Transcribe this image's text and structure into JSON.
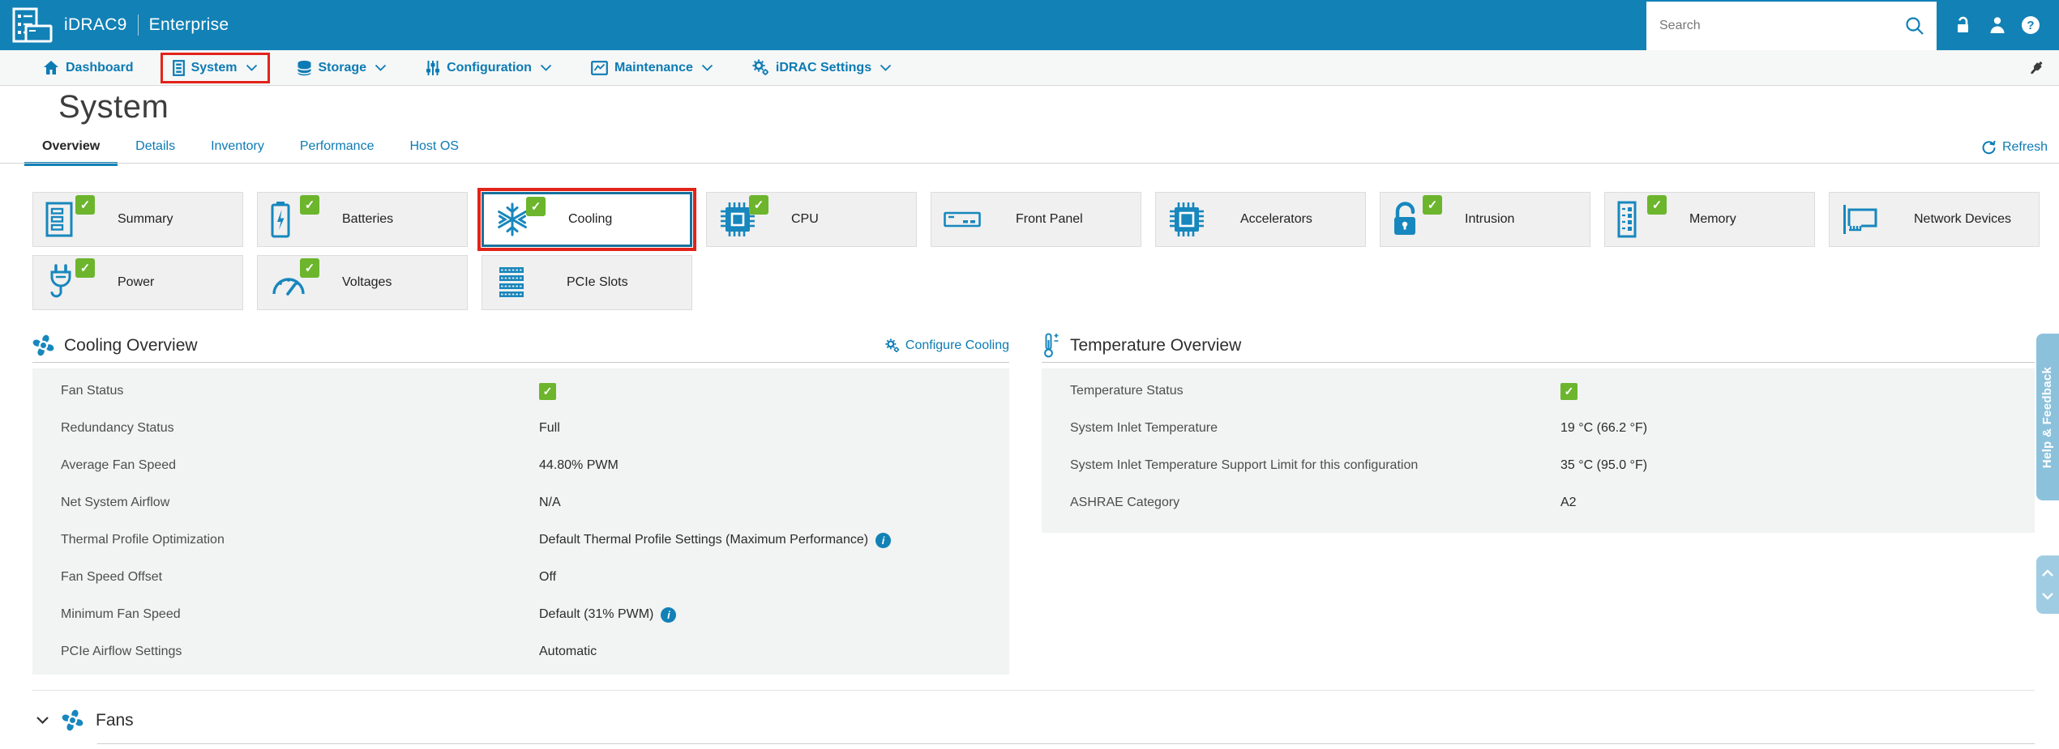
{
  "colors": {
    "header_blue": "#1181b6",
    "link_blue": "#0c7bb4",
    "tile_icon_blue": "#1787bd",
    "status_green": "#6cb52d",
    "annotation_red": "#e2231a",
    "panel_gray": "#f2f3f3",
    "help_tab_blue": "#8cc1dc",
    "scroll_button_blue": "#9fcce2"
  },
  "icons": {
    "check": "✓",
    "info": "i",
    "question": "?"
  },
  "header": {
    "brand": "iDRAC9",
    "edition": "Enterprise",
    "search_placeholder": "Search"
  },
  "nav": {
    "items": [
      {
        "label": "Dashboard",
        "dropdown": false,
        "annotated": false
      },
      {
        "label": "System",
        "dropdown": true,
        "annotated": true
      },
      {
        "label": "Storage",
        "dropdown": true,
        "annotated": false
      },
      {
        "label": "Configuration",
        "dropdown": true,
        "annotated": false
      },
      {
        "label": "Maintenance",
        "dropdown": true,
        "annotated": false
      },
      {
        "label": "iDRAC Settings",
        "dropdown": true,
        "annotated": false
      }
    ]
  },
  "page": {
    "title": "System"
  },
  "tabs": {
    "items": [
      {
        "label": "Overview",
        "active": true
      },
      {
        "label": "Details",
        "active": false
      },
      {
        "label": "Inventory",
        "active": false
      },
      {
        "label": "Performance",
        "active": false
      },
      {
        "label": "Host OS",
        "active": false
      }
    ],
    "refresh_label": "Refresh"
  },
  "tiles": {
    "items": [
      {
        "label": "Summary",
        "checked": true,
        "selected": false,
        "annotated": false
      },
      {
        "label": "Batteries",
        "checked": true,
        "selected": false,
        "annotated": false
      },
      {
        "label": "Cooling",
        "checked": true,
        "selected": true,
        "annotated": true
      },
      {
        "label": "CPU",
        "checked": true,
        "selected": false,
        "annotated": false
      },
      {
        "label": "Front Panel",
        "checked": false,
        "selected": false,
        "annotated": false
      },
      {
        "label": "Accelerators",
        "checked": false,
        "selected": false,
        "annotated": false
      },
      {
        "label": "Intrusion",
        "checked": true,
        "selected": false,
        "annotated": false
      },
      {
        "label": "Memory",
        "checked": true,
        "selected": false,
        "annotated": false
      },
      {
        "label": "Network Devices",
        "checked": false,
        "selected": false,
        "annotated": false
      },
      {
        "label": "Power",
        "checked": true,
        "selected": false,
        "annotated": false
      },
      {
        "label": "Voltages",
        "checked": true,
        "selected": false,
        "annotated": false
      },
      {
        "label": "PCIe Slots",
        "checked": false,
        "selected": false,
        "annotated": false
      }
    ]
  },
  "cooling_overview": {
    "title": "Cooling Overview",
    "configure_label": "Configure Cooling",
    "rows": [
      {
        "label": "Fan Status",
        "value": "",
        "status_ok": true
      },
      {
        "label": "Redundancy Status",
        "value": "Full"
      },
      {
        "label": "Average Fan Speed",
        "value": "44.80% PWM"
      },
      {
        "label": "Net System Airflow",
        "value": "N/A"
      },
      {
        "label": "Thermal Profile Optimization",
        "value": "Default Thermal Profile Settings (Maximum Performance)",
        "info": true
      },
      {
        "label": "Fan Speed Offset",
        "value": "Off"
      },
      {
        "label": "Minimum Fan Speed",
        "value": "Default (31% PWM)",
        "info": true
      },
      {
        "label": "PCIe Airflow Settings",
        "value": "Automatic"
      }
    ]
  },
  "temperature_overview": {
    "title": "Temperature Overview",
    "rows": [
      {
        "label": "Temperature Status",
        "value": "",
        "status_ok": true
      },
      {
        "label": "System Inlet Temperature",
        "value": "19 °C (66.2 °F)"
      },
      {
        "label": "System Inlet Temperature Support Limit for this configuration",
        "value": "35 °C (95.0 °F)"
      },
      {
        "label": "ASHRAE Category",
        "value": "A2"
      }
    ]
  },
  "fans_section": {
    "title": "Fans"
  },
  "help_tab": {
    "label": "Help & Feedback"
  }
}
